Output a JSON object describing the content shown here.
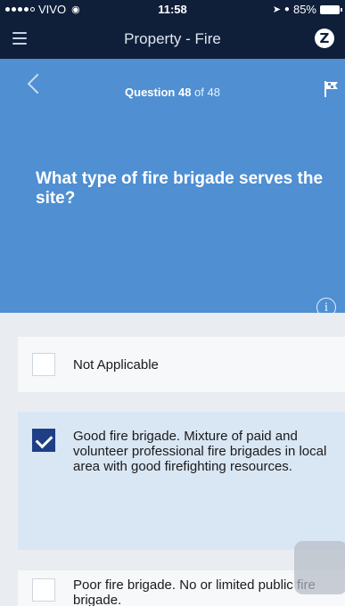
{
  "status_bar": {
    "carrier": "VIVO",
    "time": "11:58",
    "battery": "85%"
  },
  "nav": {
    "title": "Property - Fire",
    "logo_letter": "Z"
  },
  "question": {
    "counter_prefix": "Question 48",
    "counter_suffix": " of 48",
    "text": "What type of fire brigade serves the site?",
    "info_symbol": "i"
  },
  "options": [
    {
      "label": "Not Applicable",
      "checked": false
    },
    {
      "label": "Good fire brigade. Mixture of paid and volunteer professional fire brigades in local area with good firefighting resources.",
      "checked": true
    },
    {
      "label": "Poor fire brigade. No or limited public fire brigade.",
      "checked": false
    }
  ],
  "colors": {
    "nav_background": "#0f1f3a",
    "question_background": "#4f8fd2",
    "selected_option_background": "#d9e6f4",
    "checkbox_checked": "#1e3f86"
  }
}
